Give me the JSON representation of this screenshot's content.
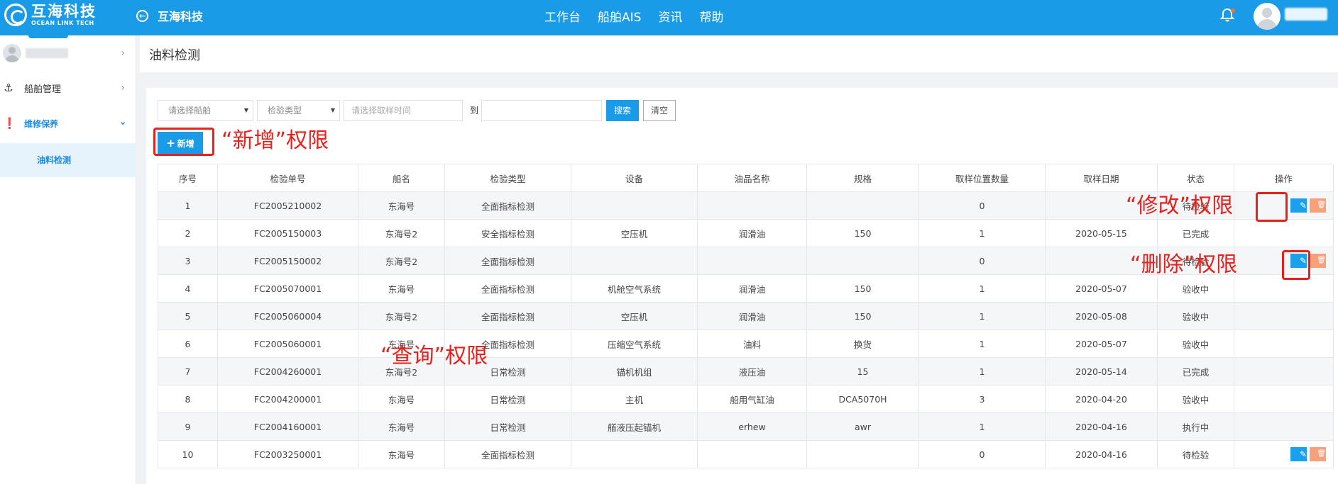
{
  "topbar": {
    "logo_cn": "互海科技",
    "logo_en": "OCEAN LINK TECH",
    "back_label": "互海科技",
    "nav": [
      "工作台",
      "船舶AIS",
      "资讯",
      "帮助"
    ]
  },
  "sidebar": {
    "items": [
      {
        "label": "船舶管理"
      },
      {
        "label": "维修保养"
      }
    ],
    "sub_active": "油料检测"
  },
  "page": {
    "title": "油料检测"
  },
  "filters": {
    "ship_placeholder": "请选择船舶",
    "type_placeholder": "检验类型",
    "time_placeholder": "请选择取样时间",
    "to_label": "到",
    "search_label": "搜索",
    "clear_label": "清空",
    "add_label": "新增"
  },
  "table": {
    "headers": [
      "序号",
      "检验单号",
      "船名",
      "检验类型",
      "设备",
      "油品名称",
      "规格",
      "取样位置数量",
      "取样日期",
      "状态",
      "操作"
    ],
    "rows": [
      {
        "no": "1",
        "code": "FC2005210002",
        "ship": "东海号",
        "type": "全面指标检测",
        "equip": "",
        "oil": "",
        "spec": "",
        "count": "0",
        "date": "",
        "status": "待检验",
        "ops": true
      },
      {
        "no": "2",
        "code": "FC2005150003",
        "ship": "东海号2",
        "type": "安全指标检测",
        "equip": "空压机",
        "oil": "润滑油",
        "spec": "150",
        "count": "1",
        "date": "2020-05-15",
        "status": "已完成",
        "ops": false
      },
      {
        "no": "3",
        "code": "FC2005150002",
        "ship": "东海号2",
        "type": "全面指标检测",
        "equip": "",
        "oil": "",
        "spec": "",
        "count": "0",
        "date": "",
        "status": "待检验",
        "ops": true
      },
      {
        "no": "4",
        "code": "FC2005070001",
        "ship": "东海号",
        "type": "全面指标检测",
        "equip": "机舱空气系统",
        "oil": "润滑油",
        "spec": "150",
        "count": "1",
        "date": "2020-05-07",
        "status": "验收中",
        "ops": false
      },
      {
        "no": "5",
        "code": "FC2005060004",
        "ship": "东海号2",
        "type": "全面指标检测",
        "equip": "空压机",
        "oil": "润滑油",
        "spec": "150",
        "count": "1",
        "date": "2020-05-08",
        "status": "验收中",
        "ops": false
      },
      {
        "no": "6",
        "code": "FC2005060001",
        "ship": "东海号",
        "type": "全面指标检测",
        "equip": "压缩空气系统",
        "oil": "油料",
        "spec": "换货",
        "count": "1",
        "date": "2020-05-07",
        "status": "验收中",
        "ops": false
      },
      {
        "no": "7",
        "code": "FC2004260001",
        "ship": "东海号2",
        "type": "日常检测",
        "equip": "锚机机组",
        "oil": "液压油",
        "spec": "15",
        "count": "1",
        "date": "2020-05-14",
        "status": "已完成",
        "ops": false
      },
      {
        "no": "8",
        "code": "FC2004200001",
        "ship": "东海号",
        "type": "日常检测",
        "equip": "主机",
        "oil": "船用气缸油",
        "spec": "DCA5070H",
        "count": "3",
        "date": "2020-04-20",
        "status": "验收中",
        "ops": false
      },
      {
        "no": "9",
        "code": "FC2004160001",
        "ship": "东海号",
        "type": "日常检测",
        "equip": "艏液压起锚机",
        "oil": "erhew",
        "spec": "awr",
        "count": "1",
        "date": "2020-04-16",
        "status": "执行中",
        "ops": false
      },
      {
        "no": "10",
        "code": "FC2003250001",
        "ship": "东海号",
        "type": "全面指标检测",
        "equip": "",
        "oil": "",
        "spec": "",
        "count": "0",
        "date": "2020-04-16",
        "status": "待检验",
        "ops": true
      }
    ]
  },
  "annotations": {
    "add": "“新增”权限",
    "query": "“查询”权限",
    "edit": "“修改”权限",
    "delete": "“删除”权限"
  }
}
